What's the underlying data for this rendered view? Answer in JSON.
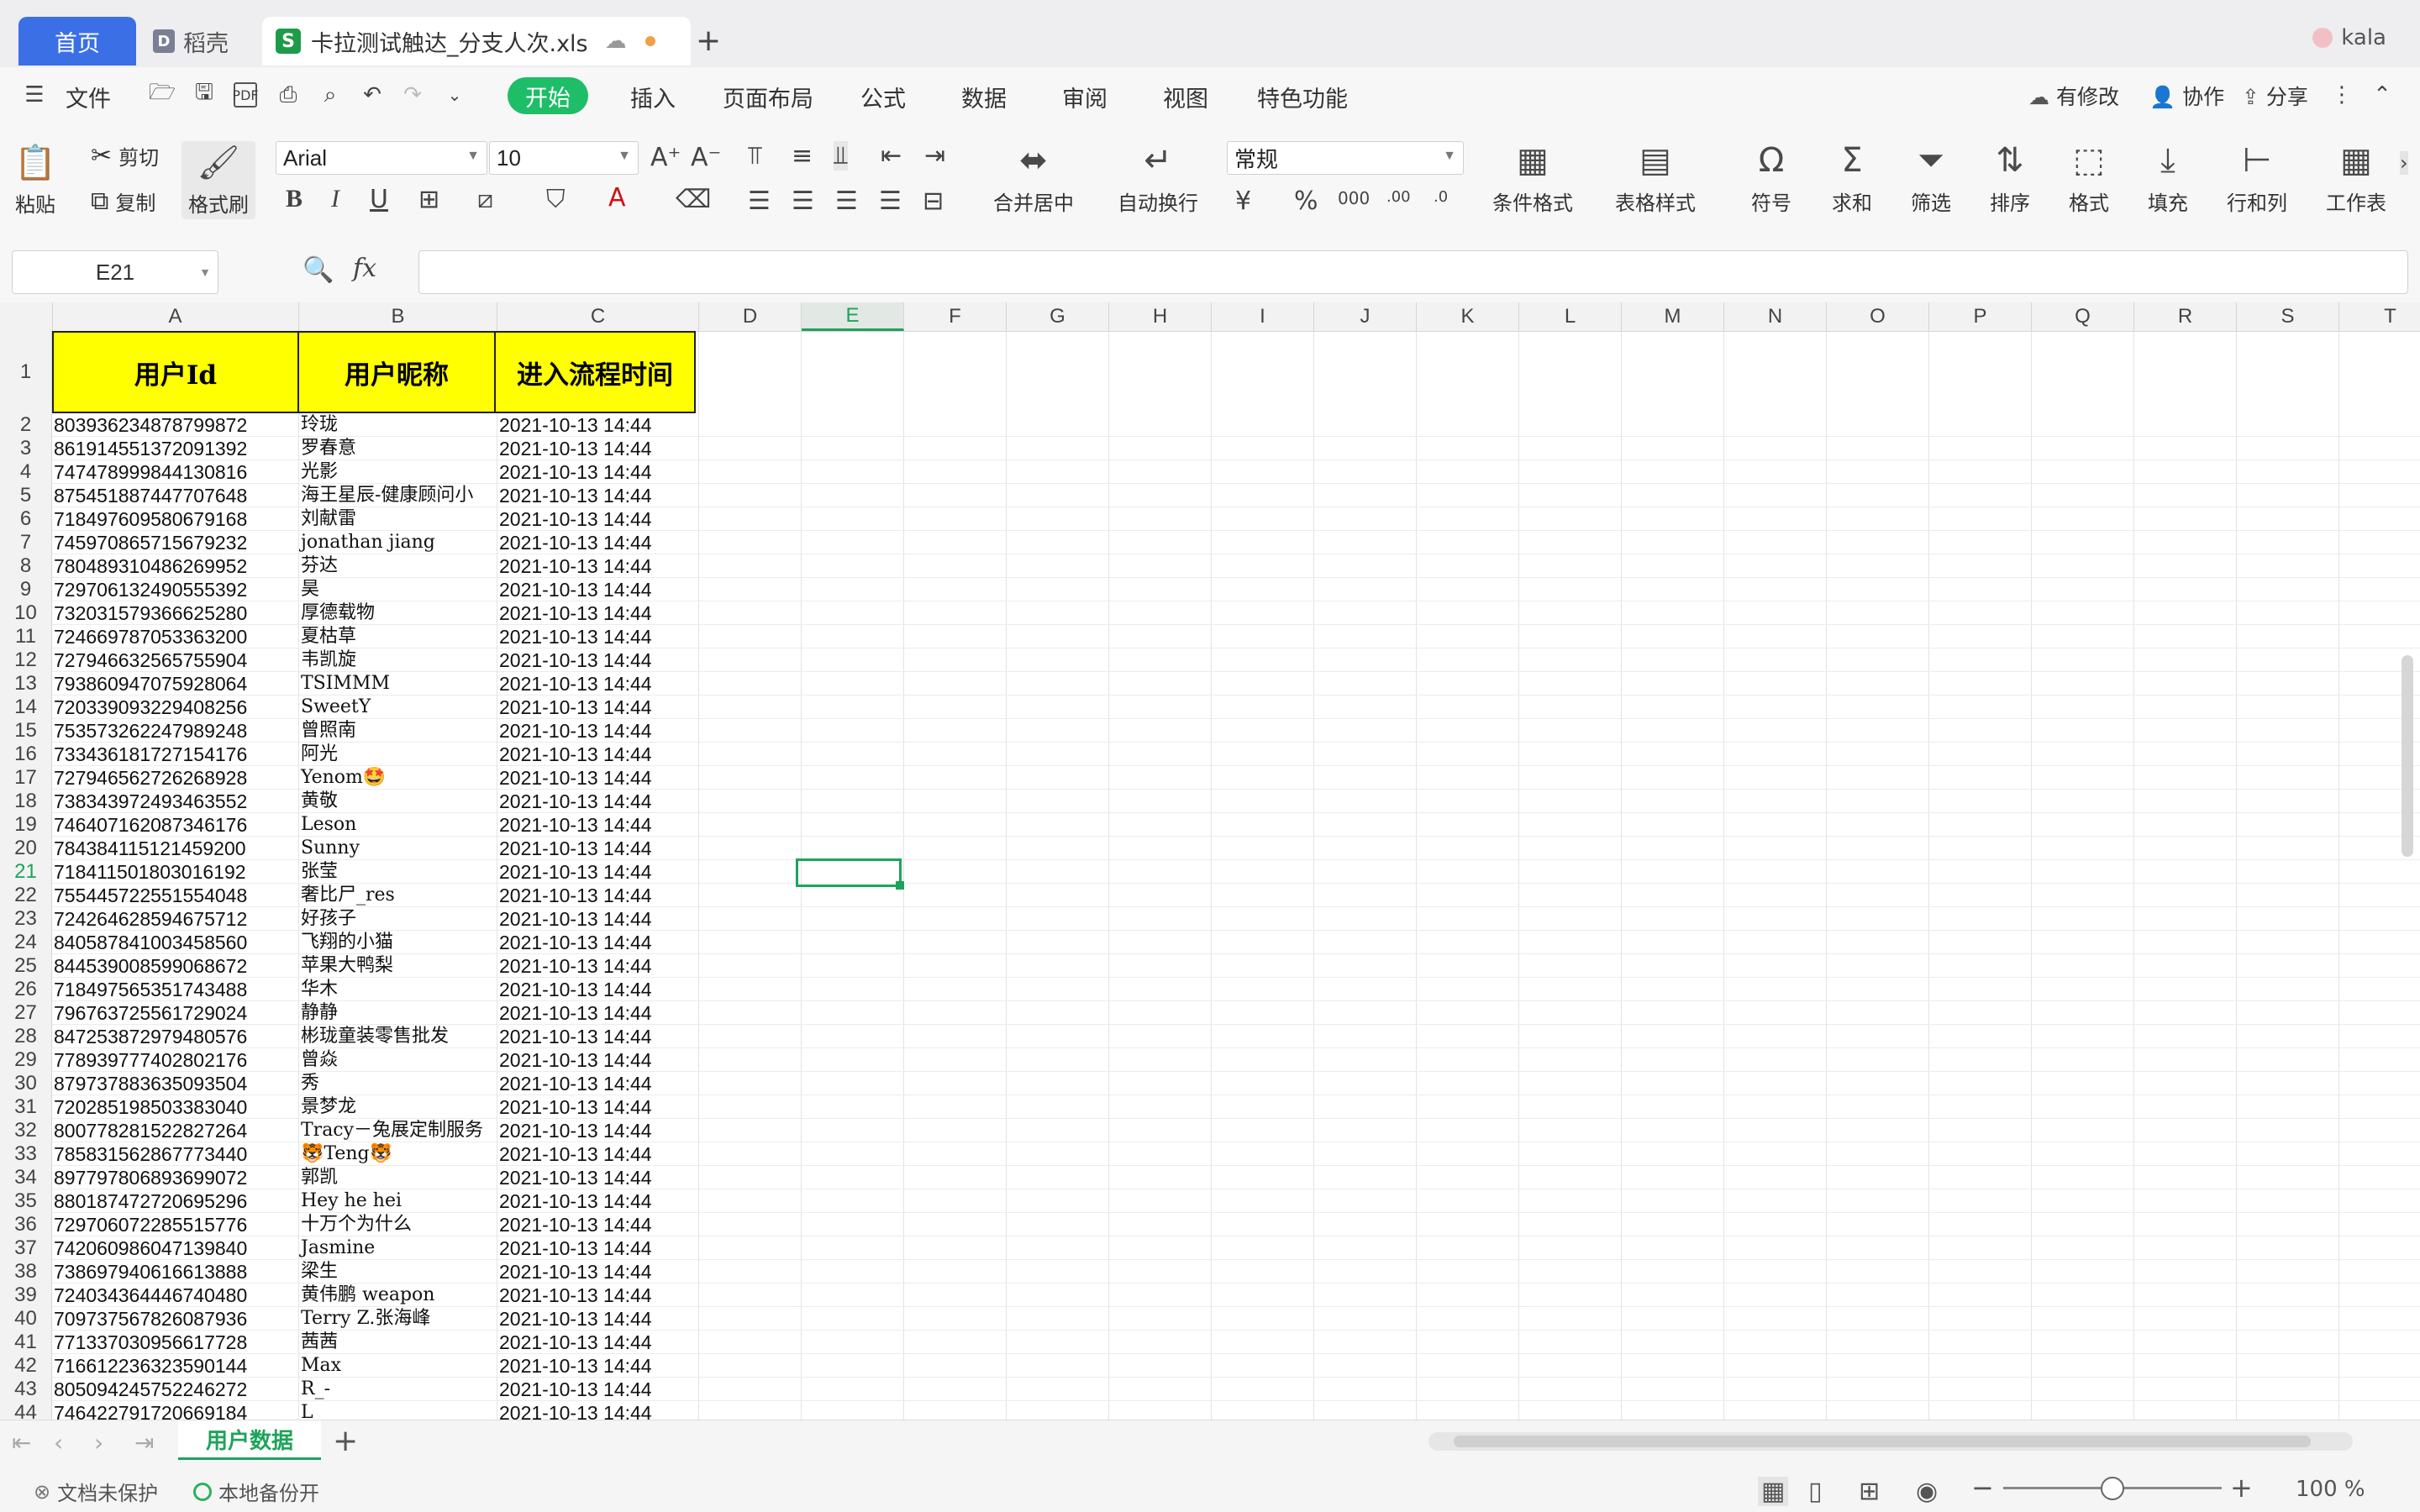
{
  "tabs": {
    "home": "首页",
    "docer": "稻壳",
    "file": "卡拉测试触达_分支人次.xls",
    "new_tab": "+",
    "user": "kala"
  },
  "menu": {
    "file": "文件",
    "items": [
      "开始",
      "插入",
      "页面布局",
      "公式",
      "数据",
      "审阅",
      "视图",
      "特色功能"
    ],
    "right": [
      "有修改",
      "协作",
      "分享"
    ]
  },
  "ribbon": {
    "paste": "粘贴",
    "cut": "剪切",
    "copy": "复制",
    "format_painter": "格式刷",
    "font": "Arial",
    "font_size": "10",
    "merge_center": "合并居中",
    "wrap": "自动换行",
    "number_format": "常规",
    "conditional": "条件格式",
    "table_style": "表格样式",
    "symbol": "符号",
    "sum": "求和",
    "filter": "筛选",
    "sort": "排序",
    "format": "格式",
    "fill": "填充",
    "rowcol": "行和列",
    "worksheet": "工作表"
  },
  "formula_bar": {
    "cell_ref": "E21",
    "fx": "fx",
    "value": ""
  },
  "columns": [
    "A",
    "B",
    "C",
    "D",
    "E",
    "F",
    "G",
    "H",
    "I",
    "J",
    "K",
    "L",
    "M",
    "N",
    "O",
    "P",
    "Q",
    "R",
    "S",
    "T"
  ],
  "selected_column": "E",
  "selected_row": "21",
  "header_row": {
    "row": "1",
    "cols": [
      "用户Id",
      "用户昵称",
      "进入流程时间"
    ]
  },
  "rows": [
    {
      "n": "2",
      "id": "803936234878799872",
      "name": "玲珑",
      "time": "2021-10-13 14:44"
    },
    {
      "n": "3",
      "id": "861914551372091392",
      "name": "罗春意",
      "time": "2021-10-13 14:44"
    },
    {
      "n": "4",
      "id": "747478999844130816",
      "name": "光影",
      "time": "2021-10-13 14:44"
    },
    {
      "n": "5",
      "id": "875451887447707648",
      "name": "海王星辰-健康顾问小",
      "time": "2021-10-13 14:44"
    },
    {
      "n": "6",
      "id": "718497609580679168",
      "name": "刘献雷",
      "time": "2021-10-13 14:44"
    },
    {
      "n": "7",
      "id": "745970865715679232",
      "name": "jonathan jiang",
      "time": "2021-10-13 14:44"
    },
    {
      "n": "8",
      "id": "780489310486269952",
      "name": "芬达",
      "time": "2021-10-13 14:44"
    },
    {
      "n": "9",
      "id": "729706132490555392",
      "name": "昊",
      "time": "2021-10-13 14:44"
    },
    {
      "n": "10",
      "id": "732031579366625280",
      "name": "厚德载物",
      "time": "2021-10-13 14:44"
    },
    {
      "n": "11",
      "id": "724669787053363200",
      "name": "夏枯草",
      "time": "2021-10-13 14:44"
    },
    {
      "n": "12",
      "id": "727946632565755904",
      "name": "韦凯旋",
      "time": "2021-10-13 14:44"
    },
    {
      "n": "13",
      "id": "793860947075928064",
      "name": "TSIMMM",
      "time": "2021-10-13 14:44"
    },
    {
      "n": "14",
      "id": "720339093229408256",
      "name": "SweetY",
      "time": "2021-10-13 14:44"
    },
    {
      "n": "15",
      "id": "753573262247989248",
      "name": "曾照南",
      "time": "2021-10-13 14:44"
    },
    {
      "n": "16",
      "id": "733436181727154176",
      "name": "阿光",
      "time": "2021-10-13 14:44"
    },
    {
      "n": "17",
      "id": "727946562726268928",
      "name": "Yenom🤩",
      "time": "2021-10-13 14:44"
    },
    {
      "n": "18",
      "id": "738343972493463552",
      "name": "黄敬",
      "time": "2021-10-13 14:44"
    },
    {
      "n": "19",
      "id": "746407162087346176",
      "name": "Leson",
      "time": "2021-10-13 14:44"
    },
    {
      "n": "20",
      "id": "784384115121459200",
      "name": "Sunny",
      "time": "2021-10-13 14:44"
    },
    {
      "n": "21",
      "id": "718411501803016192",
      "name": "张莹",
      "time": "2021-10-13 14:44"
    },
    {
      "n": "22",
      "id": "755445722551554048",
      "name": "奢比尸_res",
      "time": "2021-10-13 14:44"
    },
    {
      "n": "23",
      "id": "724264628594675712",
      "name": "好孩子",
      "time": "2021-10-13 14:44"
    },
    {
      "n": "24",
      "id": "840587841003458560",
      "name": "飞翔的小猫",
      "time": "2021-10-13 14:44"
    },
    {
      "n": "25",
      "id": "844539008599068672",
      "name": "苹果大鸭梨",
      "time": "2021-10-13 14:44"
    },
    {
      "n": "26",
      "id": "718497565351743488",
      "name": "华木",
      "time": "2021-10-13 14:44"
    },
    {
      "n": "27",
      "id": "796763725561729024",
      "name": "静静",
      "time": "2021-10-13 14:44"
    },
    {
      "n": "28",
      "id": "847253872979480576",
      "name": "彬珑童装零售批发",
      "time": "2021-10-13 14:44"
    },
    {
      "n": "29",
      "id": "778939777402802176",
      "name": "曾焱",
      "time": "2021-10-13 14:44"
    },
    {
      "n": "30",
      "id": "879737883635093504",
      "name": "秀",
      "time": "2021-10-13 14:44"
    },
    {
      "n": "31",
      "id": "720285198503383040",
      "name": "景梦龙",
      "time": "2021-10-13 14:44"
    },
    {
      "n": "32",
      "id": "800778281522827264",
      "name": "Tracy－兔展定制服务",
      "time": "2021-10-13 14:44"
    },
    {
      "n": "33",
      "id": "785831562867773440",
      "name": "🐯Teng🐯",
      "time": "2021-10-13 14:44"
    },
    {
      "n": "34",
      "id": "897797806893699072",
      "name": "郭凯",
      "time": "2021-10-13 14:44"
    },
    {
      "n": "35",
      "id": "880187472720695296",
      "name": "Hey he hei",
      "time": "2021-10-13 14:44"
    },
    {
      "n": "36",
      "id": "729706072285515776",
      "name": "十万个为什么",
      "time": "2021-10-13 14:44"
    },
    {
      "n": "37",
      "id": "742060986047139840",
      "name": "Jasmine",
      "time": "2021-10-13 14:44"
    },
    {
      "n": "38",
      "id": "738697940616613888",
      "name": "梁生",
      "time": "2021-10-13 14:44"
    },
    {
      "n": "39",
      "id": "724034364446740480",
      "name": "黄伟鹏 weapon",
      "time": "2021-10-13 14:44"
    },
    {
      "n": "40",
      "id": "709737567826087936",
      "name": "Terry Z.张海峰",
      "time": "2021-10-13 14:44"
    },
    {
      "n": "41",
      "id": "771337030956617728",
      "name": "茜茜",
      "time": "2021-10-13 14:44"
    },
    {
      "n": "42",
      "id": "716612236323590144",
      "name": "Max",
      "time": "2021-10-13 14:44"
    },
    {
      "n": "43",
      "id": "805094245752246272",
      "name": "R_-",
      "time": "2021-10-13 14:44"
    },
    {
      "n": "44",
      "id": "746422791720669184",
      "name": "L",
      "time": "2021-10-13 14:44"
    }
  ],
  "sheet": {
    "tab": "用户数据",
    "add": "+"
  },
  "status": {
    "protect": "文档未保护",
    "backup": "本地备份开",
    "zoom": "100 %"
  },
  "colors": {
    "accent": "#1ea35a",
    "home_tab": "#3a6fe6",
    "header_fill": "#ffff00"
  }
}
